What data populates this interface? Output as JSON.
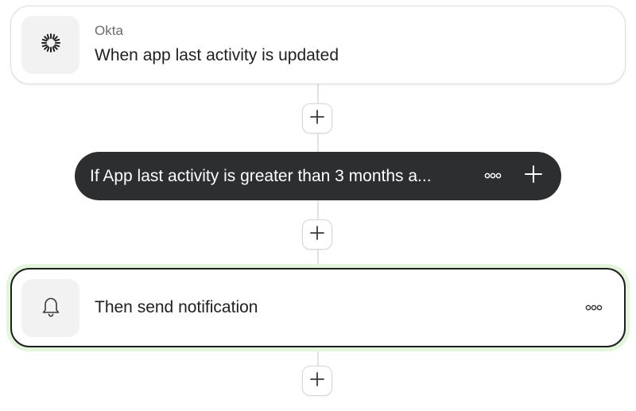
{
  "trigger": {
    "source": "Okta",
    "title": "When app last activity is updated",
    "icon": "okta-sunburst-icon"
  },
  "condition": {
    "text": "If App last activity is greater than 3 months a...",
    "more_icon": "more-horizontal-icon",
    "add_icon": "plus-icon"
  },
  "action": {
    "title": "Then send notification",
    "icon": "bell-icon",
    "more_icon": "more-horizontal-icon"
  },
  "add_step": {
    "icon": "plus-icon"
  },
  "colors": {
    "pill_background": "#2d2e30",
    "selected_glow": "#e3f5dc",
    "selected_border": "#1f1f1f",
    "connector": "#e2e2e2"
  }
}
